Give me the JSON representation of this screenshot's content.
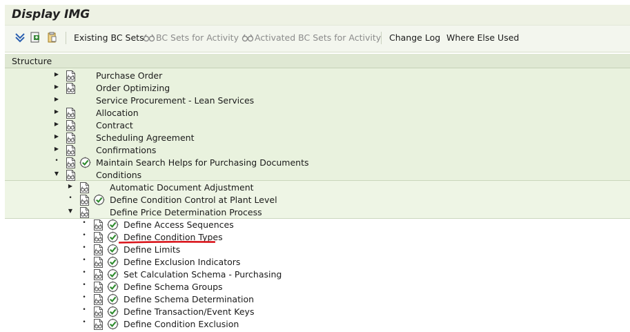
{
  "window": {
    "title": "Display IMG"
  },
  "toolbar": {
    "existing_bc_sets": "Existing BC Sets",
    "bc_sets_for_activity": "BC Sets for Activity",
    "activated_bc_sets": "Activated BC Sets for Activity",
    "change_log": "Change Log",
    "where_else_used": "Where Else Used"
  },
  "structure": {
    "header": "Structure",
    "items": [
      {
        "label": "Purchase Order",
        "level": 1,
        "expander": "collapsed",
        "doc": true,
        "activity": false
      },
      {
        "label": "Order Optimizing",
        "level": 1,
        "expander": "collapsed",
        "doc": true,
        "activity": false
      },
      {
        "label": "Service Procurement - Lean Services",
        "level": 1,
        "expander": "collapsed",
        "doc": false,
        "activity": false
      },
      {
        "label": "Allocation",
        "level": 1,
        "expander": "collapsed",
        "doc": true,
        "activity": false
      },
      {
        "label": "Contract",
        "level": 1,
        "expander": "collapsed",
        "doc": true,
        "activity": false
      },
      {
        "label": "Scheduling Agreement",
        "level": 1,
        "expander": "collapsed",
        "doc": true,
        "activity": false
      },
      {
        "label": "Confirmations",
        "level": 1,
        "expander": "collapsed",
        "doc": true,
        "activity": false
      },
      {
        "label": "Maintain Search Helps for Purchasing Documents",
        "level": 1,
        "expander": "leaf",
        "doc": true,
        "activity": true
      },
      {
        "label": "Conditions",
        "level": 1,
        "expander": "expanded",
        "doc": true,
        "activity": false
      },
      {
        "label": "Automatic Document Adjustment",
        "level": 2,
        "expander": "collapsed",
        "doc": true,
        "activity": false
      },
      {
        "label": "Define Condition Control at Plant Level",
        "level": 2,
        "expander": "leaf",
        "doc": true,
        "activity": true
      },
      {
        "label": "Define Price Determination Process",
        "level": 2,
        "expander": "expanded",
        "doc": true,
        "activity": false
      },
      {
        "label": "Define Access Sequences",
        "level": 3,
        "expander": "leaf",
        "doc": true,
        "activity": true
      },
      {
        "label": "Define Condition Types",
        "level": 3,
        "expander": "leaf",
        "doc": true,
        "activity": true,
        "highlighted": true
      },
      {
        "label": "Define Limits",
        "level": 3,
        "expander": "leaf",
        "doc": true,
        "activity": true
      },
      {
        "label": "Define Exclusion Indicators",
        "level": 3,
        "expander": "leaf",
        "doc": true,
        "activity": true
      },
      {
        "label": "Set Calculation Schema - Purchasing",
        "level": 3,
        "expander": "leaf",
        "doc": true,
        "activity": true
      },
      {
        "label": "Define Schema Groups",
        "level": 3,
        "expander": "leaf",
        "doc": true,
        "activity": true
      },
      {
        "label": "Define Schema Determination",
        "level": 3,
        "expander": "leaf",
        "doc": true,
        "activity": true
      },
      {
        "label": "Define Transaction/Event Keys",
        "level": 3,
        "expander": "leaf",
        "doc": true,
        "activity": true
      },
      {
        "label": "Define Condition Exclusion",
        "level": 3,
        "expander": "leaf",
        "doc": true,
        "activity": true
      }
    ]
  },
  "colors": {
    "highlight_underline": "#d9141b",
    "activity_icon": "#2e8b2e",
    "band_level1": "#e9f2de",
    "band_level2": "#eef5e5"
  }
}
